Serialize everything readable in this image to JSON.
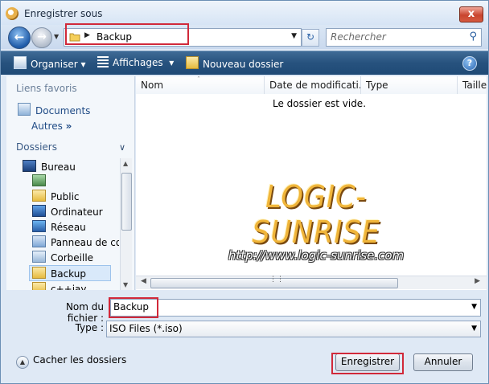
{
  "window": {
    "title": "Enregistrer sous",
    "close_label": "x"
  },
  "nav": {
    "address_path": "Backup",
    "search_placeholder": "Rechercher"
  },
  "toolbar": {
    "organize": "Organiser",
    "views": "Affichages",
    "new_folder": "Nouveau dossier",
    "help": "?"
  },
  "sidebar": {
    "favorites_header": "Liens favoris",
    "favorites": [
      {
        "label": "Documents",
        "icon": "documents-icon"
      },
      {
        "label": "Autres",
        "icon": "more-icon"
      }
    ],
    "more_suffix": "»",
    "folders_header": "Dossiers",
    "tree": [
      {
        "label": "Bureau",
        "icon": "desktop-icon"
      },
      {
        "label": "",
        "icon": "user-folder-icon"
      },
      {
        "label": "Public",
        "icon": "folder-icon"
      },
      {
        "label": "Ordinateur",
        "icon": "computer-icon"
      },
      {
        "label": "Réseau",
        "icon": "network-icon"
      },
      {
        "label": "Panneau de configuration",
        "icon": "control-panel-icon"
      },
      {
        "label": "Corbeille",
        "icon": "recycle-bin-icon"
      },
      {
        "label": "Backup",
        "icon": "folder-icon",
        "selected": true
      },
      {
        "label": "c++iay",
        "icon": "folder-icon"
      }
    ]
  },
  "file_list": {
    "columns": [
      "Nom",
      "Date de modificati...",
      "Type",
      "Taille"
    ],
    "empty_message": "Le dossier est vide."
  },
  "watermark": {
    "brand": "LOGIC-SUNRISE",
    "url": "http://www.logic-sunrise.com"
  },
  "form": {
    "filename_label": "Nom du fichier :",
    "filename_value": "Backup",
    "type_label": "Type :",
    "type_value": "ISO Files (*.iso)",
    "hide_folders": "Cacher les dossiers",
    "save_button": "Enregistrer",
    "cancel_button": "Annuler"
  },
  "colors": {
    "highlight": "#d1293a",
    "toolbar": "#27527e",
    "watermark": "#f0b53a"
  }
}
